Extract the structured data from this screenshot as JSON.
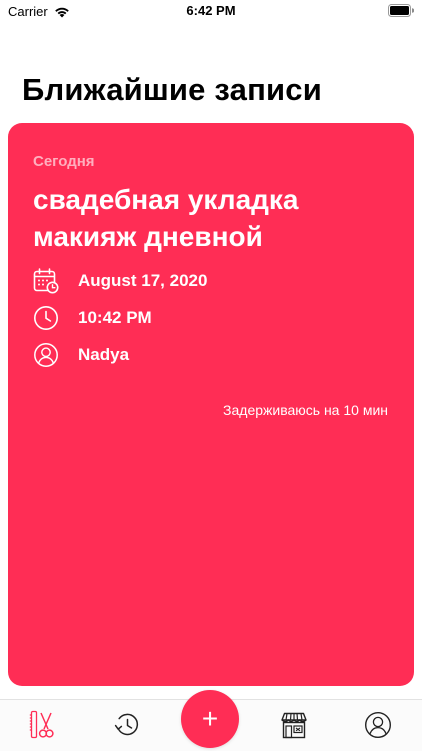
{
  "status_bar": {
    "carrier": "Carrier",
    "time": "6:42 PM"
  },
  "header": {
    "title": "Ближайшие записи"
  },
  "appointment": {
    "day_label": "Сегодня",
    "services": [
      "свадебная укладка",
      "макияж дневной"
    ],
    "date": "August 17, 2020",
    "time": "10:42 PM",
    "client": "Nadya",
    "delay_action": "Задерживаюсь на 10 мин",
    "card_color": "#ff2d55"
  },
  "tab_bar": {
    "add_label": "+",
    "icons": [
      "scissors-comb-icon",
      "clock-history-icon",
      "add-icon",
      "shop-icon",
      "profile-icon"
    ],
    "active_color": "#ff2d55",
    "inactive_color": "#222222"
  }
}
